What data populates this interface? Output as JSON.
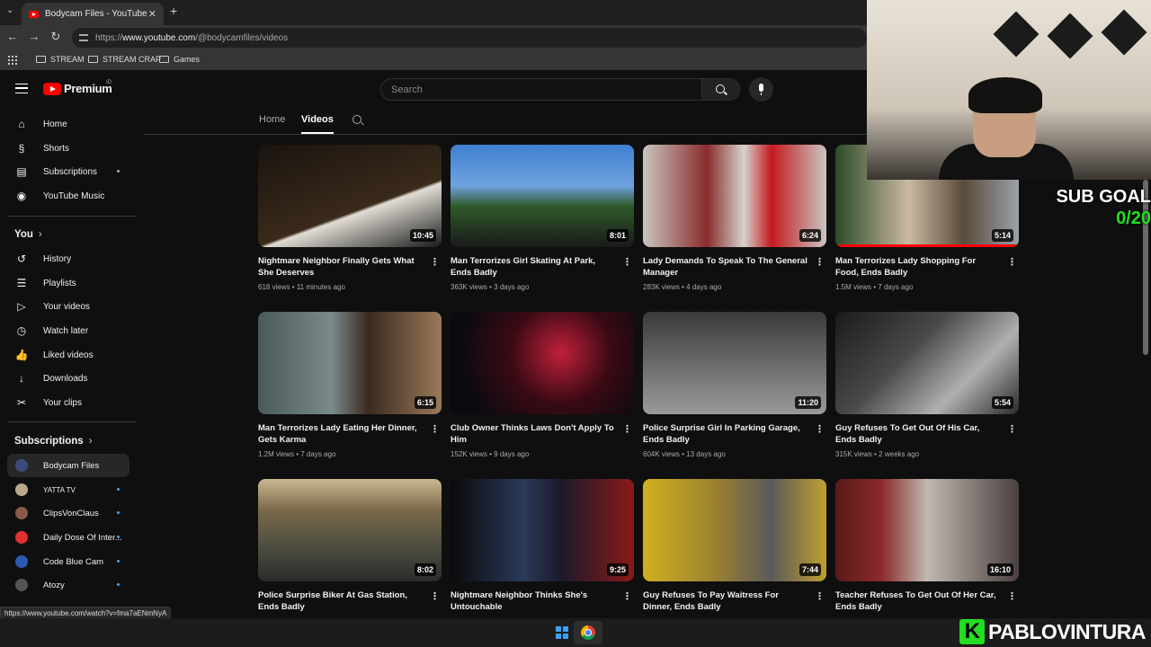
{
  "browser": {
    "tab_title": "Bodycam Files - YouTube",
    "tab_close": "✕",
    "new_tab": "+",
    "url_scheme": "https://",
    "url_host": "www.youtube.com",
    "url_path": "/@bodycamfiles/videos",
    "bookmarks": [
      "STREAM",
      "STREAM CRAP",
      "Games"
    ],
    "status_url": "https://www.youtube.com/watch?v=fma7aENmNyA"
  },
  "header": {
    "logo_text": "Premium",
    "logo_country": "ID",
    "search_placeholder": "Search"
  },
  "sidebar": {
    "main": [
      {
        "label": "Home",
        "icon": "⌂"
      },
      {
        "label": "Shorts",
        "icon": "§"
      },
      {
        "label": "Subscriptions",
        "icon": "▤"
      },
      {
        "label": "YouTube Music",
        "icon": "◉"
      }
    ],
    "you_heading": "You",
    "you": [
      {
        "label": "History",
        "icon": "↺"
      },
      {
        "label": "Playlists",
        "icon": "☰"
      },
      {
        "label": "Your videos",
        "icon": "▷"
      },
      {
        "label": "Watch later",
        "icon": "◷"
      },
      {
        "label": "Liked videos",
        "icon": "👍"
      },
      {
        "label": "Downloads",
        "icon": "↓"
      },
      {
        "label": "Your clips",
        "icon": "✂"
      }
    ],
    "subs_heading": "Subscriptions",
    "subs": [
      {
        "label": "Bodycam Files",
        "color": "#3b4a7a",
        "dot": false
      },
      {
        "label": "YATTA TV",
        "color": "#b9a98a",
        "dot": true
      },
      {
        "label": "ClipsVonClaus",
        "color": "#8a5a4a",
        "dot": true
      },
      {
        "label": "Daily Dose Of Inter...",
        "color": "#e03030",
        "dot": true
      },
      {
        "label": "Code Blue Cam",
        "color": "#2a5ab0",
        "dot": true
      },
      {
        "label": "Atozy",
        "color": "#555555",
        "dot": true
      }
    ]
  },
  "channel_tabs": [
    "Home",
    "Videos"
  ],
  "videos": [
    {
      "title": "Nightmare Neighbor Finally Gets What She Deserves",
      "views": "618 views",
      "age": "11 minutes ago",
      "duration": "10:45",
      "bg": "linear-gradient(160deg,#1a1410,#3a2a1a 60%,#e0dcd4 62%,#1a1a1a)"
    },
    {
      "title": "Man Terrorizes Girl Skating At Park, Ends Badly",
      "views": "363K views",
      "age": "3 days ago",
      "duration": "8:01",
      "bg": "linear-gradient(180deg,#3f7fd0 0%,#6fa3e0 40%,#2f5a2a 60%,#1a1a1a 100%)"
    },
    {
      "title": "Lady Demands To Speak To The General Manager",
      "views": "283K views",
      "age": "4 days ago",
      "duration": "6:24",
      "bg": "linear-gradient(90deg,#c9c5c0 0%,#8a2c2c 35%,#d6d2cc 55%,#c41a20 70%,#c9c5c0 100%)"
    },
    {
      "title": "Man Terrorizes Lady Shopping For Food, Ends Badly",
      "views": "1.5M views",
      "age": "7 days ago",
      "duration": "5:14",
      "bg": "linear-gradient(90deg,#2d4a2a 0%,#c9b9a0 40%,#5a4a3a 70%,#9aa2a8 100%)",
      "progress": 1.0
    },
    {
      "title": "Man Terrorizes Lady Eating Her Dinner, Gets Karma",
      "views": "1.2M views",
      "age": "7 days ago",
      "duration": "6:15",
      "bg": "linear-gradient(90deg,#4a5a5a 0%,#7a8a8a 40%,#3a2a20 60%,#9a7a5a 100%)"
    },
    {
      "title": "Club Owner Thinks Laws Don't Apply To Him",
      "views": "152K views",
      "age": "9 days ago",
      "duration": "",
      "bg": "radial-gradient(circle at 60% 40%,#c0203a 0%,#3a0a14 40%,#0a0a10 80%)"
    },
    {
      "title": "Police Surprise Girl In Parking Garage, Ends Badly",
      "views": "604K views",
      "age": "13 days ago",
      "duration": "11:20",
      "bg": "linear-gradient(180deg,#3a3a3a 0%,#6a6a6a 50%,#9a9a9a 100%)"
    },
    {
      "title": "Guy Refuses To Get Out Of His Car, Ends Badly",
      "views": "315K views",
      "age": "2 weeks ago",
      "duration": "5:54",
      "bg": "linear-gradient(135deg,#1a1a1a 0%,#4a4a4a 40%,#b0b0b0 70%,#2a2a2a 100%)"
    },
    {
      "title": "Police Surprise Biker At Gas Station, Ends Badly",
      "views": "",
      "age": "",
      "duration": "8:02",
      "bg": "linear-gradient(180deg,#c9b890 0%,#7a6a4a 30%,#4a4a40 70%,#2a2a2a 100%)"
    },
    {
      "title": "Nightmare Neighbor Thinks She's Untouchable",
      "views": "",
      "age": "",
      "duration": "9:25",
      "bg": "linear-gradient(90deg,#0a0a0a 0%,#2a3a5a 40%,#1a1a2a 60%,#8a1a1a 100%)"
    },
    {
      "title": "Guy Refuses To Pay Waitress For Dinner, Ends Badly",
      "views": "",
      "age": "",
      "duration": "7:44",
      "bg": "linear-gradient(90deg,#d0b020 0%,#9a8030 40%,#5a5a5a 70%,#c0a030 100%)"
    },
    {
      "title": "Teacher Refuses To Get Out Of Her Car, Ends Badly",
      "views": "",
      "age": "",
      "duration": "16:10",
      "bg": "linear-gradient(90deg,#5a1a1a 0%,#8a2a2a 25%,#c0b8b0 50%,#4a4040 100%)"
    }
  ],
  "overlay": {
    "sub_goal_label": "SUB GOAL",
    "sub_goal_count": "0/20",
    "brand_letter": "K",
    "brand_name": "PABLOVINTURA"
  }
}
